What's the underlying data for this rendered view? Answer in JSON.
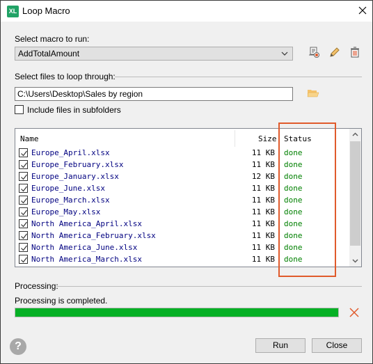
{
  "window": {
    "app_icon_text": "XL",
    "title": "Loop Macro"
  },
  "macro": {
    "label": "Select macro to run:",
    "selected": "AddTotalAmount"
  },
  "files": {
    "label": "Select files to loop through:",
    "path": "C:\\Users\\Desktop\\Sales by region",
    "include_subfolders_label": "Include files in subfolders",
    "include_subfolders_checked": false
  },
  "list": {
    "columns": {
      "name": "Name",
      "size": "Size",
      "status": "Status"
    },
    "rows": [
      {
        "name": "Europe_April.xlsx",
        "size": "11 KB",
        "status": "done",
        "checked": true
      },
      {
        "name": "Europe_February.xlsx",
        "size": "11 KB",
        "status": "done",
        "checked": true
      },
      {
        "name": "Europe_January.xlsx",
        "size": "12 KB",
        "status": "done",
        "checked": true
      },
      {
        "name": "Europe_June.xlsx",
        "size": "11 KB",
        "status": "done",
        "checked": true
      },
      {
        "name": "Europe_March.xlsx",
        "size": "11 KB",
        "status": "done",
        "checked": true
      },
      {
        "name": "Europe_May.xlsx",
        "size": "11 KB",
        "status": "done",
        "checked": true
      },
      {
        "name": "North America_April.xlsx",
        "size": "11 KB",
        "status": "done",
        "checked": true
      },
      {
        "name": "North America_February.xlsx",
        "size": "11 KB",
        "status": "done",
        "checked": true
      },
      {
        "name": "North America_June.xlsx",
        "size": "11 KB",
        "status": "done",
        "checked": true
      },
      {
        "name": "North America_March.xlsx",
        "size": "11 KB",
        "status": "done",
        "checked": true
      }
    ]
  },
  "processing": {
    "label": "Processing:",
    "status_text": "Processing is completed.",
    "progress_percent": 100
  },
  "buttons": {
    "help": "?",
    "run": "Run",
    "close": "Close"
  },
  "colors": {
    "progress": "#06b025",
    "status_done": "#008000",
    "highlight": "#e05a2b",
    "app_icon": "#21a366"
  }
}
